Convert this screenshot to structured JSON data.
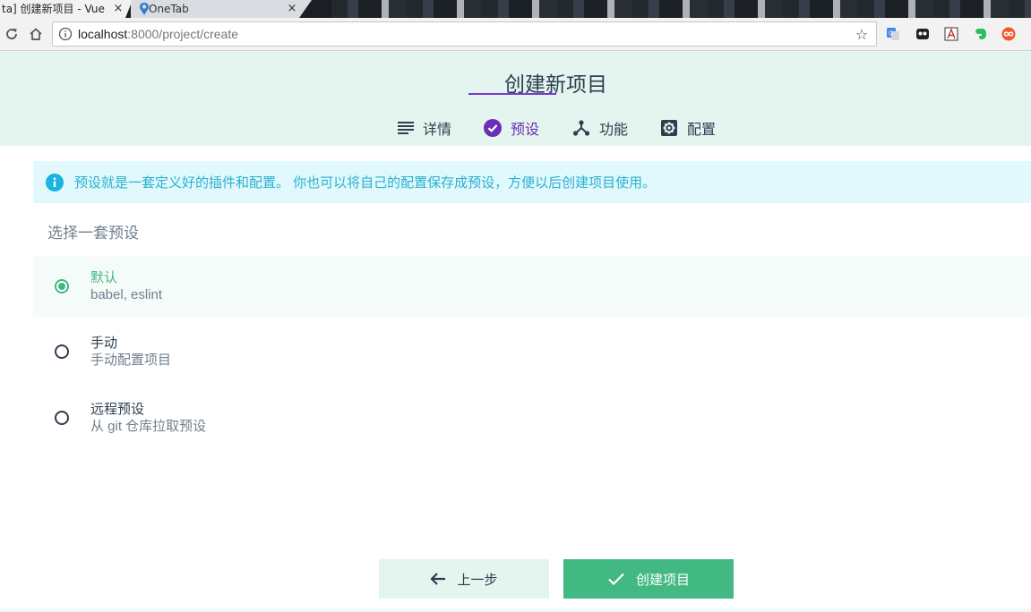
{
  "browser": {
    "tabs": [
      {
        "title": "ta] 创建新项目 - Vue",
        "close": "×",
        "active": true
      },
      {
        "title": "OneTab",
        "close": "×",
        "active": false
      }
    ],
    "url_host": "localhost",
    "url_rest": ":8000/project/create"
  },
  "header": {
    "title": "创建新项目",
    "steps": [
      {
        "label": "详情",
        "icon": "list-icon"
      },
      {
        "label": "预设",
        "icon": "check-circle-icon",
        "active": true
      },
      {
        "label": "功能",
        "icon": "fork-icon"
      },
      {
        "label": "配置",
        "icon": "gear-icon"
      }
    ]
  },
  "info": {
    "text": "预设就是一套定义好的插件和配置。 你也可以将自己的配置保存成预设，方便以后创建项目使用。"
  },
  "presets": {
    "title": "选择一套预设",
    "options": [
      {
        "name": "默认",
        "desc": "babel, eslint",
        "selected": true
      },
      {
        "name": "手动",
        "desc": "手动配置项目",
        "selected": false
      },
      {
        "name": "远程预设",
        "desc": "从 git 仓库拉取预设",
        "selected": false
      }
    ]
  },
  "footer": {
    "prev_label": "上一步",
    "create_label": "创建项目"
  },
  "colors": {
    "accent": "#42b883",
    "header_bg": "#e4f4ee",
    "active_step": "#6b2eb5",
    "info_bg": "#e1f9fc",
    "info_text": "#2ab0d0",
    "text_dark": "#2c3e50"
  }
}
